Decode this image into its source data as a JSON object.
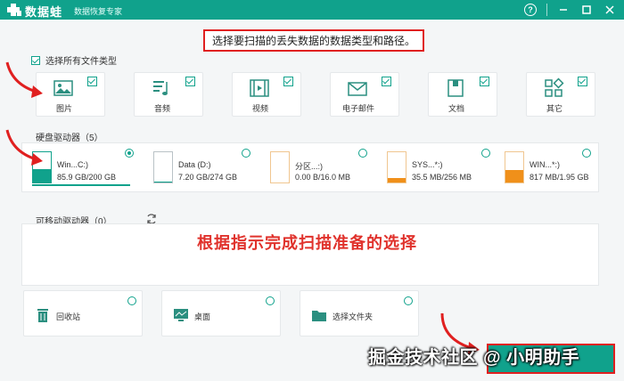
{
  "app": {
    "name": "数据蛙",
    "subtitle": "数据恢复专家",
    "brand_color": "#10a28c",
    "window_controls": [
      "help-icon",
      "minimize-icon",
      "maximize-icon",
      "close-icon"
    ]
  },
  "instruction": "选择要扫描的丢失数据的数据类型和路径。",
  "file_types": {
    "select_all_label": "选择所有文件类型",
    "select_all_checked": true,
    "items": [
      {
        "label": "图片",
        "icon": "image-icon",
        "checked": true
      },
      {
        "label": "音频",
        "icon": "music-icon",
        "checked": true
      },
      {
        "label": "视频",
        "icon": "video-icon",
        "checked": true
      },
      {
        "label": "电子邮件",
        "icon": "mail-icon",
        "checked": true
      },
      {
        "label": "文档",
        "icon": "document-icon",
        "checked": true
      },
      {
        "label": "其它",
        "icon": "other-icon",
        "checked": true
      }
    ]
  },
  "hard_drives": {
    "title": "硬盘驱动器（5）",
    "drives": [
      {
        "name": "Win...C:)",
        "size": "85.9 GB/200 GB",
        "selected": true,
        "usage": 0.43
      },
      {
        "name": "Data (D:)",
        "size": "7.20 GB/274 GB",
        "selected": false,
        "usage": 0.03
      },
      {
        "name": "分区...:)",
        "size": "0.00  B/16.0 MB",
        "selected": false,
        "usage": 0.0
      },
      {
        "name": "SYS...*:)",
        "size": "35.5 MB/256 MB",
        "selected": false,
        "usage": 0.14
      },
      {
        "name": "WIN...*:)",
        "size": "817 MB/1.95 GB",
        "selected": false,
        "usage": 0.42
      }
    ]
  },
  "removable": {
    "title": "可移动驱动器（0）",
    "note": "根据指示完成扫描准备的选择"
  },
  "locations": [
    {
      "label": "回收站",
      "icon": "trash-icon"
    },
    {
      "label": "桌面",
      "icon": "desktop-icon"
    },
    {
      "label": "选择文件夹",
      "icon": "folder-icon"
    }
  ],
  "watermark": "掘金技术社区 @ 小明助手"
}
